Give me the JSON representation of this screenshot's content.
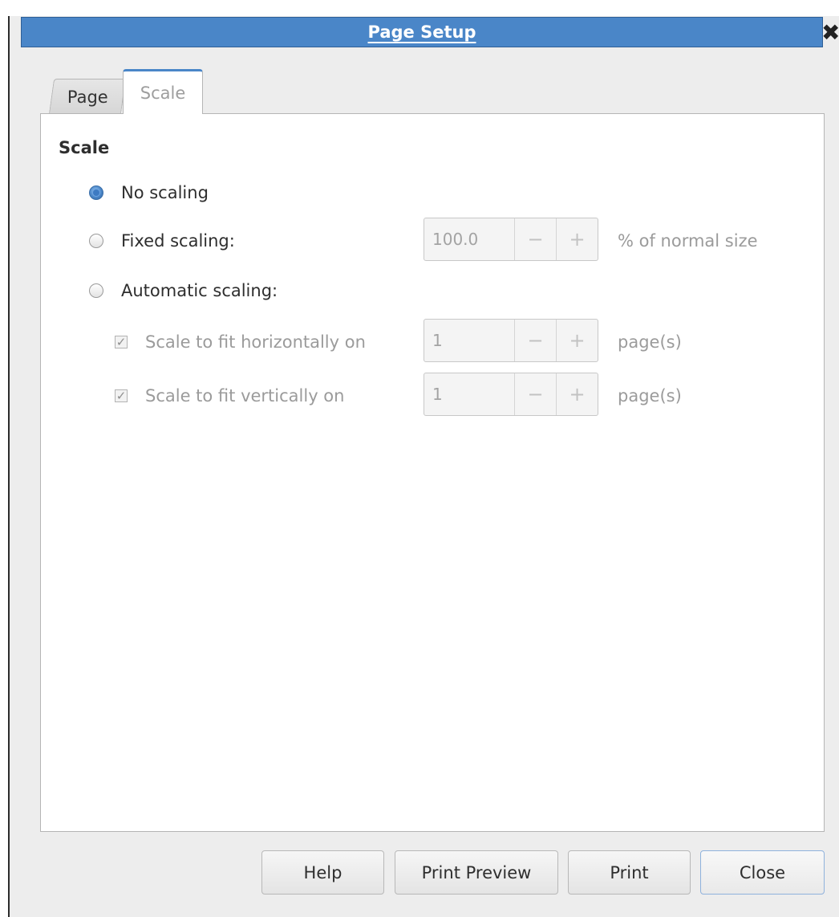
{
  "window": {
    "title": "Page Setup",
    "close_symbol": "✕"
  },
  "tabs": [
    {
      "label": "Page",
      "active": false
    },
    {
      "label": "Scale",
      "active": true
    }
  ],
  "scale_section": {
    "title": "Scale",
    "no_scaling": {
      "label": "No scaling",
      "checked": true
    },
    "fixed_scaling": {
      "label": "Fixed scaling:",
      "checked": false,
      "value": "100.0",
      "unit": "% of normal size"
    },
    "automatic_scaling": {
      "label": "Automatic scaling:",
      "checked": false
    },
    "fit_horizontally": {
      "label": "Scale to fit horizontally on",
      "checked": true,
      "value": "1",
      "unit": "page(s)"
    },
    "fit_vertically": {
      "label": "Scale to fit vertically on",
      "checked": true,
      "value": "1",
      "unit": "page(s)"
    },
    "spin_minus": "−",
    "spin_plus": "+"
  },
  "buttons": {
    "help": "Help",
    "print_preview": "Print Preview",
    "print": "Print",
    "close": "Close"
  },
  "colors": {
    "titlebar": "#4a86c8",
    "accent": "#4a86c8"
  }
}
